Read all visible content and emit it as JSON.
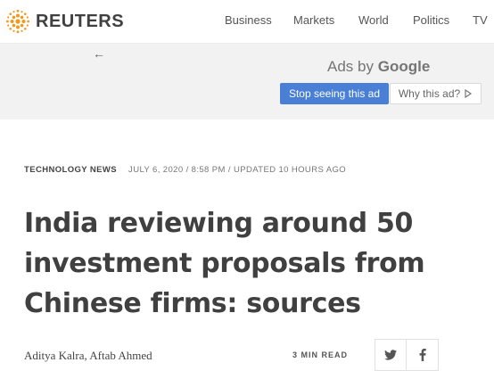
{
  "header": {
    "logo_text": "REUTERS",
    "nav": [
      "Business",
      "Markets",
      "World",
      "Politics",
      "TV"
    ]
  },
  "ad": {
    "ads_by": "Ads by",
    "google": "Google",
    "stop_label": "Stop seeing this ad",
    "why_label": "Why this ad?"
  },
  "article": {
    "channel": "TECHNOLOGY NEWS",
    "dateline": "JULY 6, 2020 / 8:58 PM / UPDATED 10 HOURS AGO",
    "headline": "India reviewing around 50 investment proposals from Chinese firms: sources",
    "byline": "Aditya Kalra, Aftab Ahmed",
    "read_time": "3 MIN READ"
  },
  "colors": {
    "brand_orange": "#f29a1f",
    "stop_button": "#4a7fd6"
  },
  "icons": {
    "back": "left-arrow-icon",
    "why": "triangle-play-icon",
    "share1": "twitter-icon",
    "share2": "facebook-icon"
  }
}
